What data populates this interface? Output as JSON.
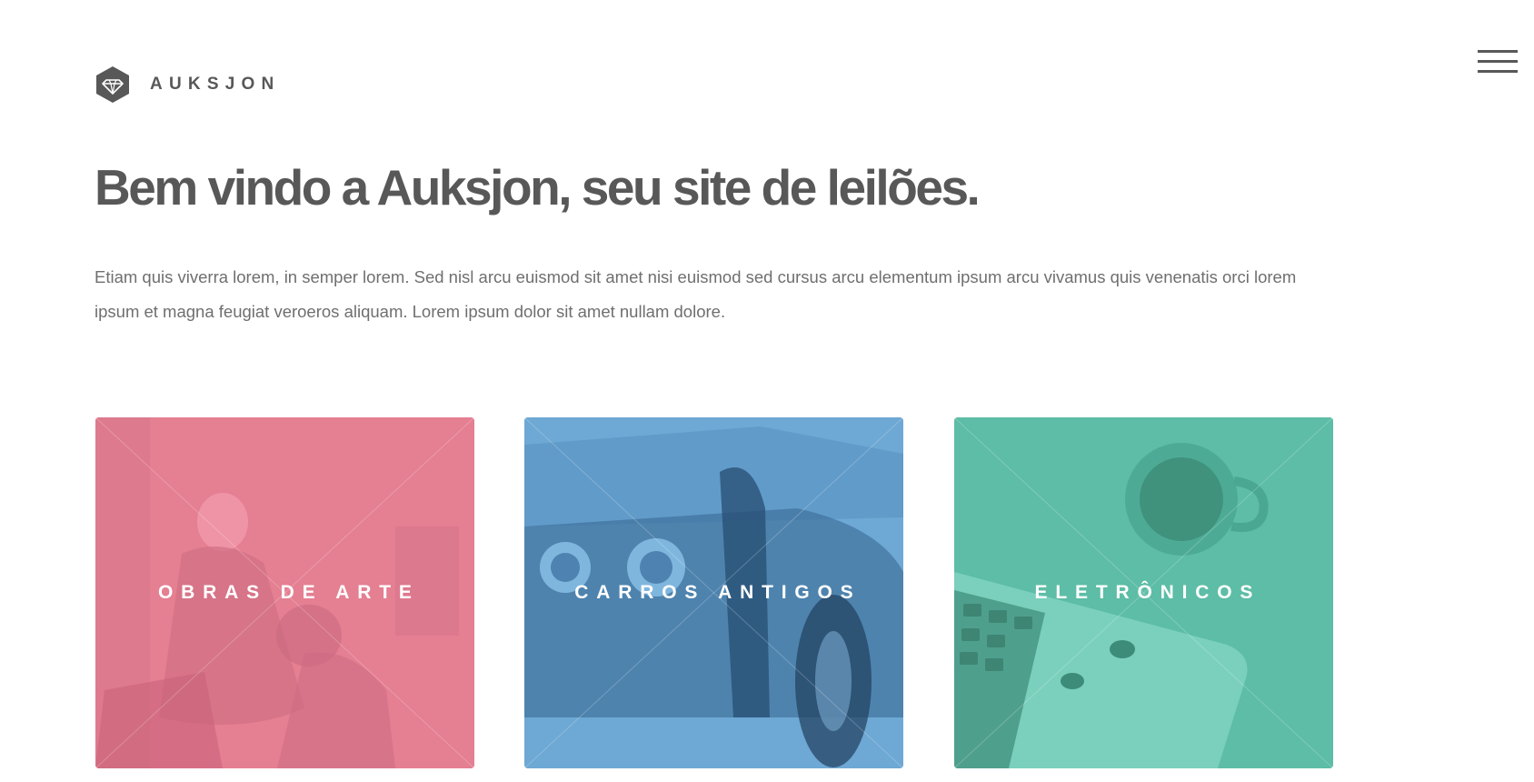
{
  "brand": {
    "name": "AUKSJON",
    "icon": "diamond-icon"
  },
  "header": {
    "menu_icon": "hamburger-menu-icon"
  },
  "hero": {
    "title": "Bem vindo a Auksjon, seu site de leilões.",
    "text": "Etiam quis viverra lorem, in semper lorem. Sed nisl arcu euismod sit amet nisi euismod sed cursus arcu elementum ipsum arcu vivamus quis venenatis orci lorem ipsum et magna feugiat veroeros aliquam. Lorem ipsum dolor sit amet nullam dolore."
  },
  "tiles": [
    {
      "label": "OBRAS DE ARTE",
      "color": "#e57f92"
    },
    {
      "label": "CARROS ANTIGOS",
      "color": "#6ea8d4"
    },
    {
      "label": "ELETRÔNICOS",
      "color": "#5dbda6"
    }
  ]
}
